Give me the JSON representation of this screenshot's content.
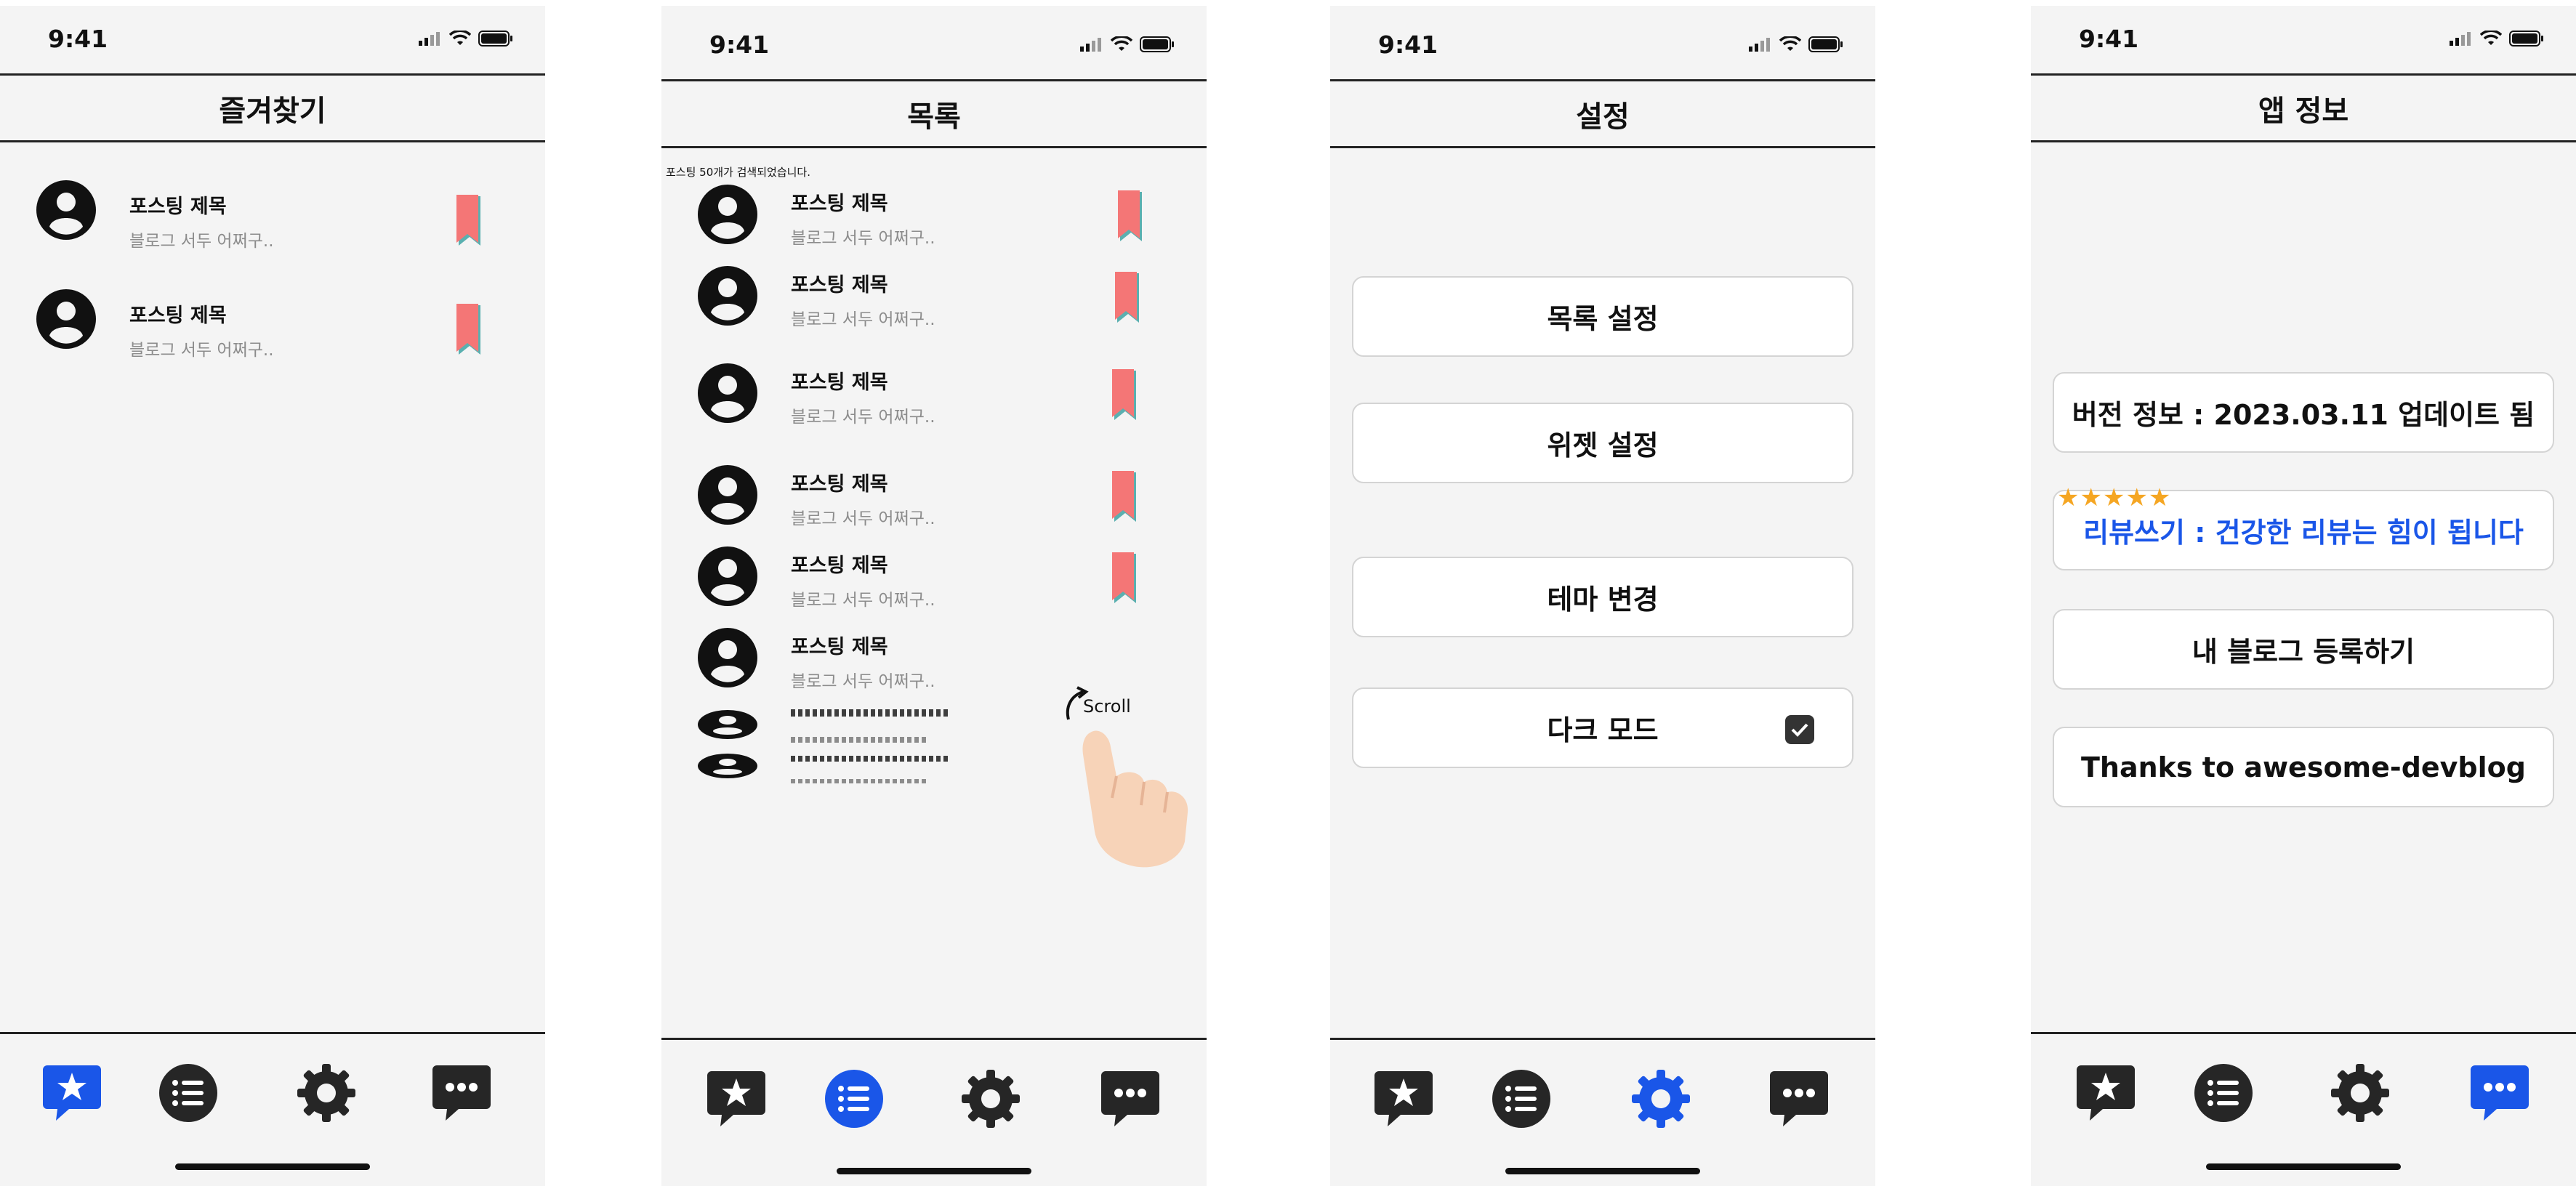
{
  "status": {
    "time": "9:41"
  },
  "screens": {
    "favorites": {
      "title": "즐겨찾기",
      "items": [
        {
          "title": "포스팅 제목",
          "subtitle": "블로그 서두 어쩌구.."
        },
        {
          "title": "포스팅 제목",
          "subtitle": "블로그 서두 어쩌구.."
        }
      ],
      "active_tab": "favorites"
    },
    "list": {
      "title": "목록",
      "result_count": "포스팅 50개가 검색되었습니다.",
      "items": [
        {
          "title": "포스팅 제목",
          "subtitle": "블로그 서두 어쩌구.."
        },
        {
          "title": "포스팅 제목",
          "subtitle": "블로그 서두 어쩌구.."
        },
        {
          "title": "포스팅 제목",
          "subtitle": "블로그 서두 어쩌구.."
        },
        {
          "title": "포스팅 제목",
          "subtitle": "블로그 서두 어쩌구.."
        },
        {
          "title": "포스팅 제목",
          "subtitle": "블로그 서두 어쩌구.."
        },
        {
          "title": "포스팅 제목",
          "subtitle": "블로그 서두 어쩌구.."
        }
      ],
      "scroll_hint": "Scroll",
      "active_tab": "list"
    },
    "settings": {
      "title": "설정",
      "buttons": {
        "list_settings": "목록 설정",
        "widget_settings": "위젯 설정",
        "theme_change": "테마 변경",
        "dark_mode": "다크 모드"
      },
      "dark_mode_checked": true,
      "active_tab": "settings"
    },
    "app_info": {
      "title": "앱 정보",
      "version": "버전 정보 : 2023.03.11 업데이트 됨",
      "review": "리뷰쓰기 : 건강한 리뷰는 힘이 됩니다",
      "review_stars": 5,
      "register_blog": "내 블로그 등록하기",
      "thanks": "Thanks to awesome-devblog",
      "active_tab": "info"
    }
  },
  "tabs": [
    "favorites-star-icon",
    "list-icon",
    "gear-icon",
    "chat-bubble-icon"
  ],
  "colors": {
    "accent": "#1a56e8",
    "bookmark": "#f47676",
    "bookmark_shadow": "#5ab0b0",
    "background": "#f4f4f4",
    "icon_dark": "#262626",
    "star": "#f5a623"
  }
}
